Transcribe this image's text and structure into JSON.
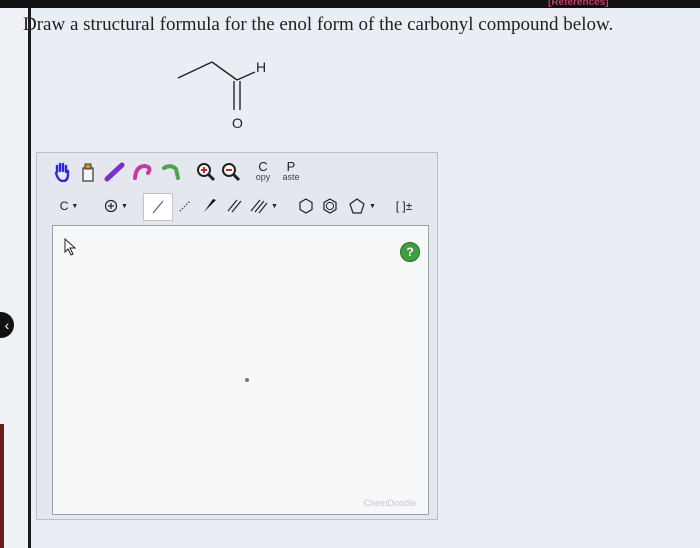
{
  "header": {
    "references_link": "[References]"
  },
  "question": {
    "text": "Draw a structural formula for the enol form of the carbonyl compound below."
  },
  "structure": {
    "h_label": "H",
    "o_label": "O"
  },
  "toolbar": {
    "copy_top": "C",
    "copy_bottom": "opy",
    "paste_top": "P",
    "paste_bottom": "aste",
    "element_label": "C",
    "brackets_label": "[ ]±",
    "icons": [
      "hand-icon",
      "eraser-icon",
      "pencil-icon",
      "lasso-icon",
      "rotate-icon",
      "zoom-in-icon",
      "zoom-out-icon"
    ]
  },
  "canvas": {
    "help_label": "?",
    "watermark": "ChemDoodle"
  },
  "colors": {
    "help_green": "#3f9e3f",
    "link_red": "#c33d66"
  }
}
